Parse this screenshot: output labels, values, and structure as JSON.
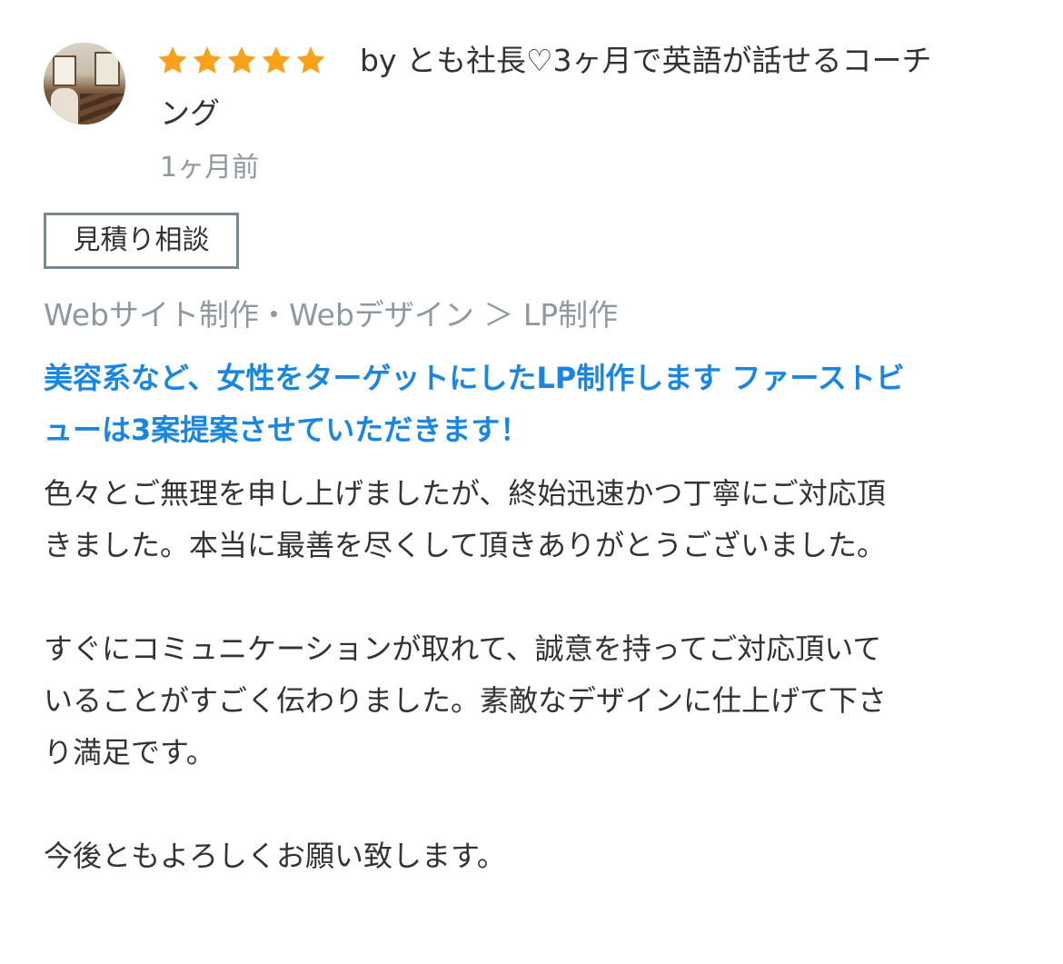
{
  "rating": {
    "stars": 5,
    "max_stars": 5,
    "star_color": "#f7a21a"
  },
  "reviewer": {
    "line1": "by とも社長♡3ヶ月で英語が話せるコーチ",
    "line2": "ング"
  },
  "timestamp": "1ヶ月前",
  "tag": "見積り相談",
  "category": "Webサイト制作・Webデザイン ＞ LP制作",
  "service_title": {
    "line1": "美容系など、女性をターゲットにしたLP制作します ファーストビ",
    "line2": "ューは3案提案させていただきます！",
    "color": "#1a86e0"
  },
  "body": {
    "p1_line1": "色々とご無理を申し上げましたが、終始迅速かつ丁寧にご対応頂",
    "p1_line2": "きました。本当に最善を尽くして頂きありがとうございました。",
    "p2_line1": "すぐにコミュニケーションが取れて、誠意を持ってご対応頂いて",
    "p2_line2": "いることがすごく伝わりました。素敵なデザインに仕上げて下さ",
    "p2_line3": "り満足です。",
    "p3_line1": "今後ともよろしくお願い致します。"
  }
}
